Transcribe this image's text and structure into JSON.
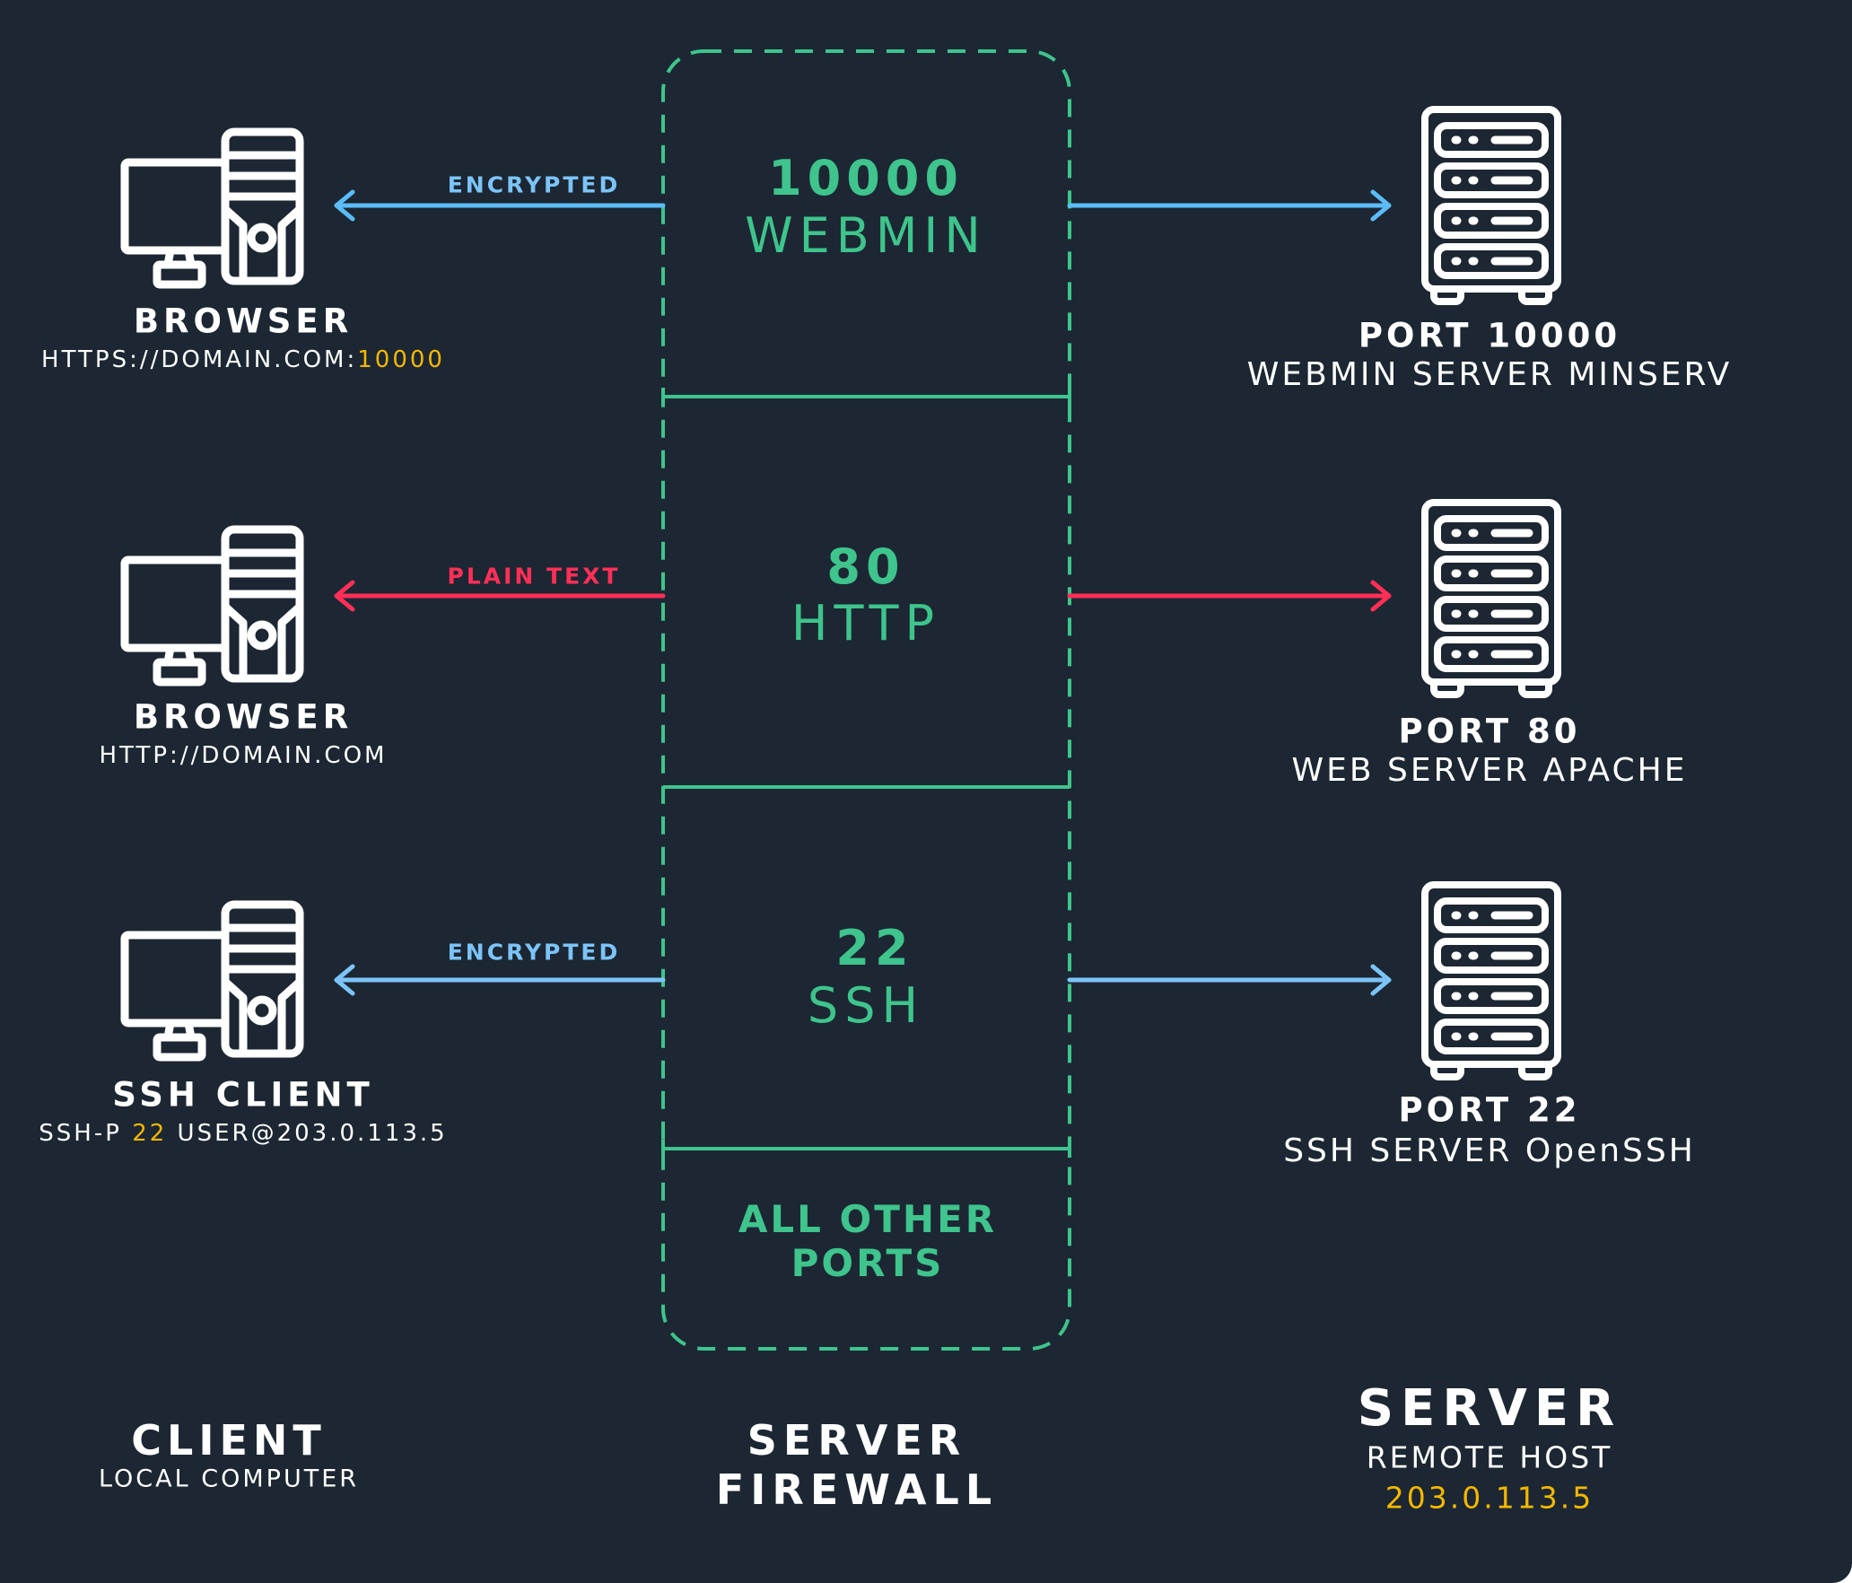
{
  "colors": {
    "background": "#1c2733",
    "firewall_green": "#3ec48c",
    "encrypted_blue": "#5bbcf7",
    "encrypted_label_blue": "#7cc4f7",
    "plaintext_red": "#ff2e57",
    "highlight_yellow": "#f5b800",
    "text_white": "#ffffff"
  },
  "client": {
    "title": "CLIENT",
    "subtitle": "LOCAL COMPUTER",
    "rows": [
      {
        "name": "BROWSER",
        "detail_prefix": "HTTPS://DOMAIN.COM:",
        "detail_highlight": "10000",
        "detail_suffix": "",
        "icon": "desktop-computer-icon"
      },
      {
        "name": "BROWSER",
        "detail_prefix": "HTTP://DOMAIN.COM",
        "detail_highlight": "",
        "detail_suffix": "",
        "icon": "desktop-computer-icon"
      },
      {
        "name": "SSH CLIENT",
        "detail_prefix": "SSH-P ",
        "detail_highlight": "22",
        "detail_suffix": " USER@203.0.113.5",
        "icon": "desktop-computer-icon"
      }
    ]
  },
  "connections": [
    {
      "label": "ENCRYPTED",
      "type": "encrypted",
      "direction": "bidirectional"
    },
    {
      "label": "PLAIN TEXT",
      "type": "plaintext",
      "direction": "bidirectional"
    },
    {
      "label": "ENCRYPTED",
      "type": "encrypted",
      "direction": "bidirectional"
    }
  ],
  "firewall": {
    "title_line1": "SERVER",
    "title_line2": "FIREWALL",
    "sections": [
      {
        "port": "10000",
        "service": "WEBMIN"
      },
      {
        "port": "80",
        "service": "HTTP"
      },
      {
        "port": "22",
        "service": "SSH"
      },
      {
        "line1": "ALL OTHER",
        "line2": "PORTS"
      }
    ]
  },
  "server": {
    "title": "SERVER",
    "subtitle": "REMOTE HOST",
    "ip": "203.0.113.5",
    "rows": [
      {
        "port_label": "PORT 10000",
        "service": "WEBMIN SERVER MINSERV",
        "icon": "server-rack-icon"
      },
      {
        "port_label": "PORT 80",
        "service": "WEB SERVER APACHE",
        "icon": "server-rack-icon"
      },
      {
        "port_label": "PORT 22",
        "service": "SSH SERVER OpenSSH",
        "icon": "server-rack-icon"
      }
    ]
  }
}
